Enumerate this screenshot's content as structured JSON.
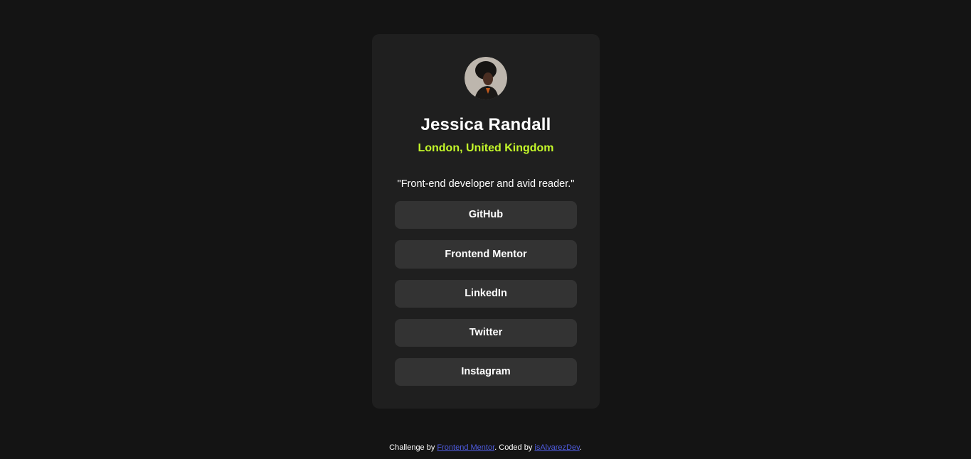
{
  "profile": {
    "name": "Jessica Randall",
    "location": "London, United Kingdom",
    "bio": "\"Front-end developer and avid reader.\""
  },
  "links": [
    {
      "label": "GitHub"
    },
    {
      "label": "Frontend Mentor"
    },
    {
      "label": "LinkedIn"
    },
    {
      "label": "Twitter"
    },
    {
      "label": "Instagram"
    }
  ],
  "footer": {
    "prefix": "Challenge by ",
    "challenge_link": "Frontend Mentor",
    "middle": ". Coded by ",
    "author_link": "isAlvarezDev",
    "suffix": "."
  },
  "colors": {
    "page_bg": "#141414",
    "card_bg": "#1f1f1f",
    "button_bg": "#333333",
    "accent": "#c4f82a",
    "footer_link": "#4f5ce0"
  }
}
